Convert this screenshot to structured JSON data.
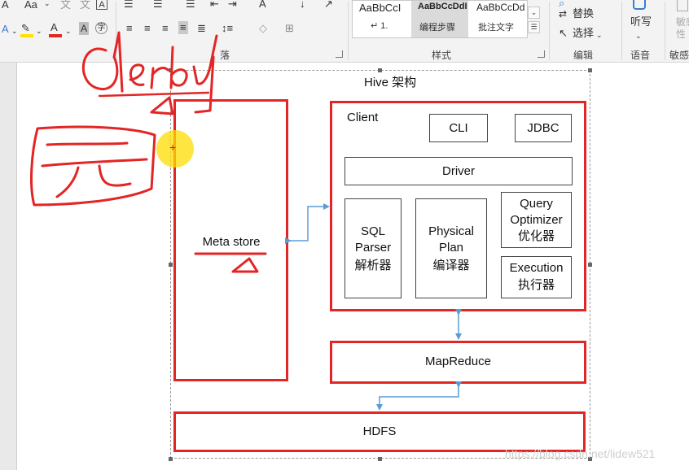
{
  "ribbon": {
    "font_size_btn": "Aa",
    "clear_format_icon": "A",
    "styles": [
      {
        "sample": "AaBbCcI",
        "name": "↵ 1."
      },
      {
        "sample": "AaBbCcDdI",
        "name": "编程步骤"
      },
      {
        "sample": "AaBbCcDd",
        "name": "批注文字"
      }
    ],
    "groups": {
      "paragraph": "落",
      "styles": "样式",
      "editing": "编辑",
      "voice": "语音",
      "sensitivity": "敏感"
    },
    "replace_label": "替换",
    "select_label": "选择",
    "dictate_label": "听写",
    "sensitivity_btn": "敏感\n性",
    "accent_colors": {
      "highlight": "#ffe100",
      "font_color": "#e32525"
    }
  },
  "diagram": {
    "title": "Hive 架构",
    "metastore": "Meta store",
    "client": "Client",
    "cli": "CLI",
    "jdbc": "JDBC",
    "driver": "Driver",
    "sql_parser": [
      "SQL",
      "Parser",
      "解析器"
    ],
    "physical_plan": [
      "Physical",
      "Plan",
      "编译器"
    ],
    "query_optimizer": [
      "Query",
      "Optimizer",
      "优化器"
    ],
    "execution": [
      "Execution",
      "执行器"
    ],
    "mapreduce": "MapReduce",
    "hdfs": "HDFS",
    "frame_color": "#e32525",
    "arrow_color": "#5b9bd5"
  },
  "handwriting": {
    "word": "derby",
    "char": "元"
  },
  "watermark": "https://blog.csdn.net/lidew521"
}
